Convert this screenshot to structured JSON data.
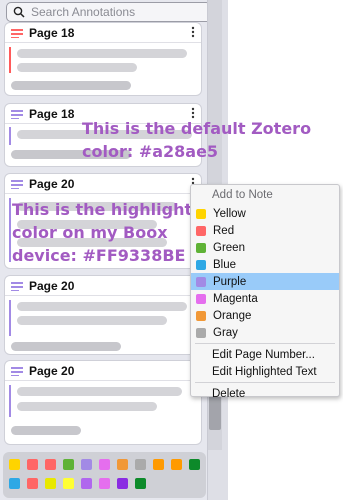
{
  "search": {
    "placeholder": "Search Annotations"
  },
  "cards": [
    {
      "page": "Page 18"
    },
    {
      "page": "Page 18"
    },
    {
      "page": "Page 20"
    },
    {
      "page": "Page 20"
    },
    {
      "page": "Page 20"
    }
  ],
  "overlay": {
    "default_line1": "This is the default Zotero",
    "default_line2": "color: #a28ae5",
    "boox_line1": "This is the highlight",
    "boox_line2": "color on my Boox",
    "boox_line3": "device: #FF9338BE"
  },
  "menu": {
    "header": "Add to Note",
    "colors": [
      {
        "label": "Yellow",
        "color": "#ffd400"
      },
      {
        "label": "Red",
        "color": "#ff6666"
      },
      {
        "label": "Green",
        "color": "#5fb236"
      },
      {
        "label": "Blue",
        "color": "#2ea8e5"
      },
      {
        "label": "Purple",
        "color": "#a28ae5"
      },
      {
        "label": "Magenta",
        "color": "#e56eee"
      },
      {
        "label": "Orange",
        "color": "#f19837"
      },
      {
        "label": "Gray",
        "color": "#aaaaaa"
      }
    ],
    "actions": {
      "edit_page": "Edit Page Number...",
      "edit_text": "Edit Highlighted Text",
      "delete": "Delete"
    }
  },
  "palette": {
    "row1": [
      "#ffd400",
      "#ff6666",
      "#ff6666",
      "#5fb236",
      "#a28ae5",
      "#e56eee",
      "#f19837",
      "#aaaaaa",
      "#ff9a00",
      "#ff9a00",
      "#0d8a2a"
    ],
    "row2": [
      "#2ea8e5",
      "#ff6666",
      "#e8e800",
      "#ffff33",
      "#b067ee",
      "#e56eee",
      "#8a2be2",
      "#0d8a2a"
    ]
  }
}
